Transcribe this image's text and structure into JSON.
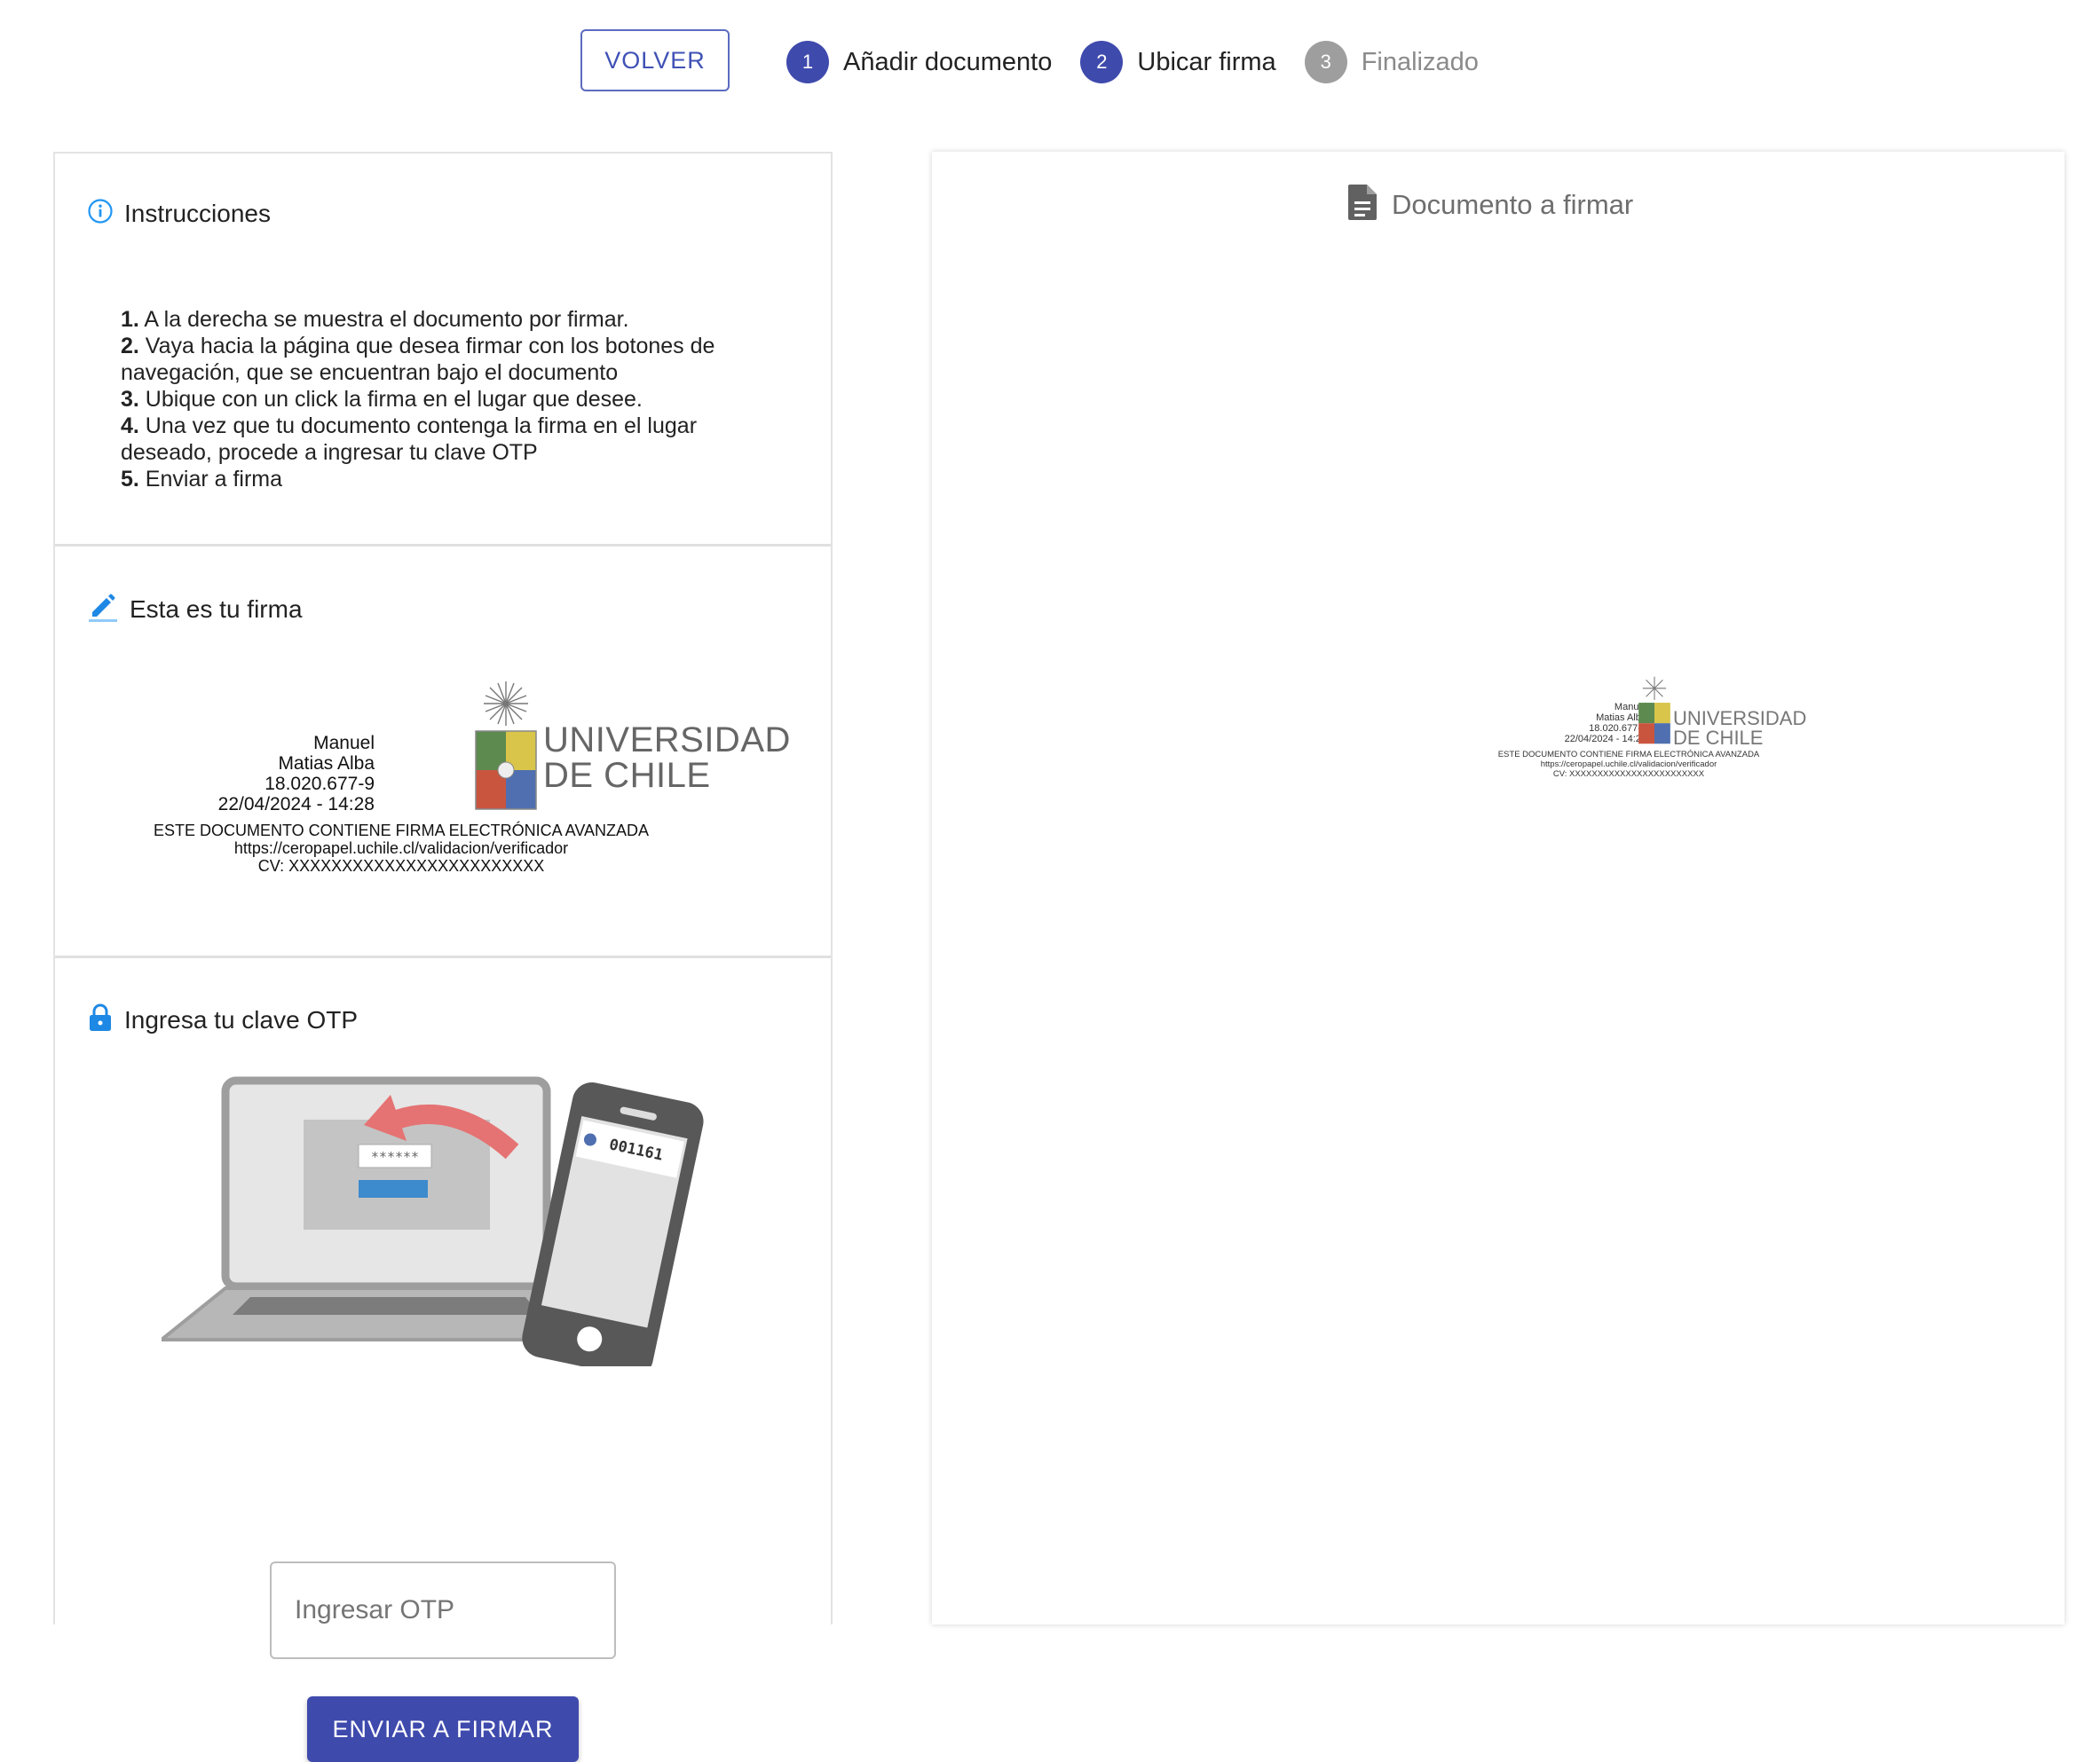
{
  "header": {
    "back_label": "VOLVER",
    "steps": [
      {
        "number": "1",
        "label": "Añadir documento",
        "state": "done"
      },
      {
        "number": "2",
        "label": "Ubicar firma",
        "state": "active"
      },
      {
        "number": "3",
        "label": "Finalizado",
        "state": "pending"
      }
    ]
  },
  "instructions": {
    "title": "Instrucciones",
    "items": [
      {
        "num": "1.",
        "text": " A la derecha se muestra el documento por firmar."
      },
      {
        "num": "2.",
        "text": " Vaya hacia la página que desea firmar con los botones de navegación, que se encuentran bajo el documento"
      },
      {
        "num": "3.",
        "text": " Ubique con un click la firma en el lugar que desee."
      },
      {
        "num": "4.",
        "text": " Una vez que tu documento contenga la firma en el lugar deseado, procede a ingresar tu clave OTP"
      },
      {
        "num": "5.",
        "text": " Enviar a firma"
      }
    ]
  },
  "signature": {
    "title": "Esta es tu firma",
    "lines": [
      "Manuel",
      "Matias Alba",
      "18.020.677-9",
      "22/04/2024 - 14:28"
    ],
    "institution_line1": "UNIVERSIDAD",
    "institution_line2": "DE CHILE",
    "footer_lines": [
      "ESTE DOCUMENTO CONTIENE FIRMA ELECTRÓNICA AVANZADA",
      "https://ceropapel.uchile.cl/validacion/verificador",
      "CV: XXXXXXXXXXXXXXXXXXXXXXXX"
    ]
  },
  "otp": {
    "title": "Ingresa tu clave OTP",
    "illustration": {
      "masked_field": "******",
      "phone_code": "001161"
    },
    "input_placeholder": "Ingresar OTP",
    "input_value": "",
    "submit_label": "ENVIAR A FIRMAR"
  },
  "document": {
    "title": "Documento a firmar"
  },
  "colors": {
    "primary": "#3f4aad",
    "info_icon": "#2196f3",
    "disabled_step": "#9e9e9e"
  }
}
